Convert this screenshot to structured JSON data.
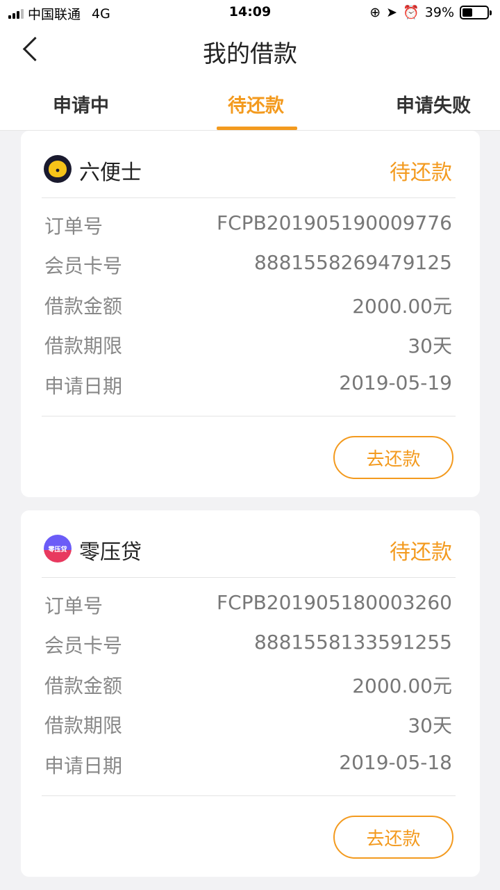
{
  "status_bar": {
    "carrier": "中国联通",
    "network": "4G",
    "time": "14:09",
    "battery": "39%"
  },
  "nav": {
    "title": "我的借款"
  },
  "tabs": [
    {
      "label": "申请中",
      "active": false
    },
    {
      "label": "待还款",
      "active": true
    },
    {
      "label": "申请失败",
      "active": false
    }
  ],
  "loans": [
    {
      "brand": "六便士",
      "status": "待还款",
      "fields": [
        {
          "key": "订单号",
          "value": "FCPB201905190009776"
        },
        {
          "key": "会员卡号",
          "value": "8881558269479125"
        },
        {
          "key": "借款金额",
          "value": "2000.00元"
        },
        {
          "key": "借款期限",
          "value": "30天"
        },
        {
          "key": "申请日期",
          "value": "2019-05-19"
        }
      ],
      "action": "去还款"
    },
    {
      "brand": "零压贷",
      "logo_text": "零压贷",
      "status": "待还款",
      "fields": [
        {
          "key": "订单号",
          "value": "FCPB201905180003260"
        },
        {
          "key": "会员卡号",
          "value": "8881558133591255"
        },
        {
          "key": "借款金额",
          "value": "2000.00元"
        },
        {
          "key": "借款期限",
          "value": "30天"
        },
        {
          "key": "申请日期",
          "value": "2019-05-18"
        }
      ],
      "action": "去还款"
    }
  ],
  "colors": {
    "accent": "#f39a1e",
    "background": "#f2f2f4"
  }
}
